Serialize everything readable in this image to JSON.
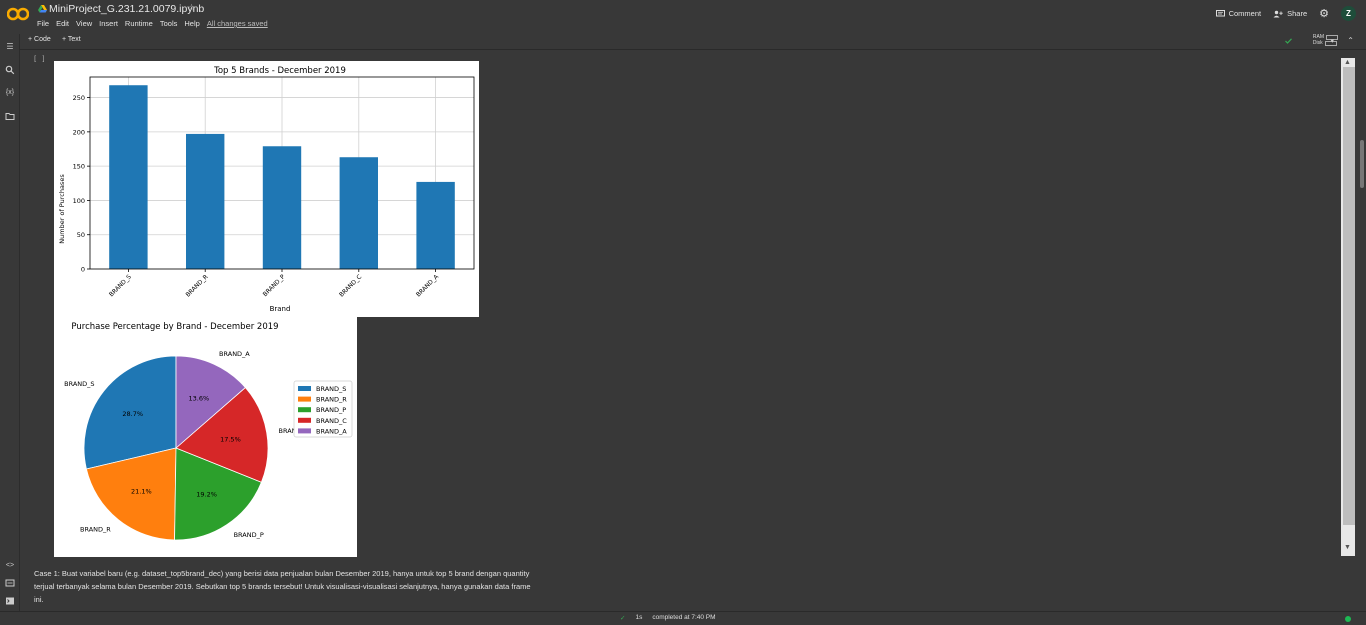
{
  "header": {
    "file_title": "MiniProject_G.231.21.0079.ipynb",
    "menu": [
      "File",
      "Edit",
      "View",
      "Insert",
      "Runtime",
      "Tools",
      "Help"
    ],
    "saved_status": "All changes saved",
    "comment_label": "Comment",
    "share_label": "Share",
    "avatar_letter": "Z"
  },
  "toolbar": {
    "code_label": "Code",
    "text_label": "Text",
    "ram_label": "RAM",
    "disk_label": "Disk"
  },
  "cell": {
    "bracket": "[ ]"
  },
  "colors": {
    "brand_s": "#1f77b4",
    "brand_r": "#ff7f0e",
    "brand_p": "#2ca02c",
    "brand_c": "#d62728",
    "brand_a": "#9467bd"
  },
  "chart_data": [
    {
      "type": "bar",
      "title": "Top 5 Brands - December 2019",
      "xlabel": "Brand",
      "ylabel": "Number of Purchases",
      "categories": [
        "BRAND_S",
        "BRAND_R",
        "BRAND_P",
        "BRAND_C",
        "BRAND_A"
      ],
      "values": [
        268,
        197,
        179,
        163,
        127
      ],
      "ylim": [
        0,
        280
      ],
      "yticks": [
        0,
        50,
        100,
        150,
        200,
        250
      ],
      "grid": true
    },
    {
      "type": "pie",
      "title": "Purchase Percentage by Brand - December 2019",
      "categories": [
        "BRAND_S",
        "BRAND_R",
        "BRAND_P",
        "BRAND_C",
        "BRAND_A"
      ],
      "values": [
        28.7,
        21.1,
        19.2,
        17.5,
        13.6
      ],
      "value_labels": [
        "28.7%",
        "21.1%",
        "19.2%",
        "17.5%",
        "13.6%"
      ],
      "legend": "right"
    }
  ],
  "case_text": "Case 1: Buat variabel baru (e.g. dataset_top5brand_dec) yang berisi data penjualan bulan Desember 2019, hanya untuk top 5 brand dengan quantity terjual terbanyak selama bulan Desember 2019. Sebutkan top 5 brands tersebut! Untuk visualisasi-visualisasi selanjutnya, hanya gunakan data frame ini.",
  "status": {
    "duration": "1s",
    "completed": "completed at 7:40 PM"
  }
}
